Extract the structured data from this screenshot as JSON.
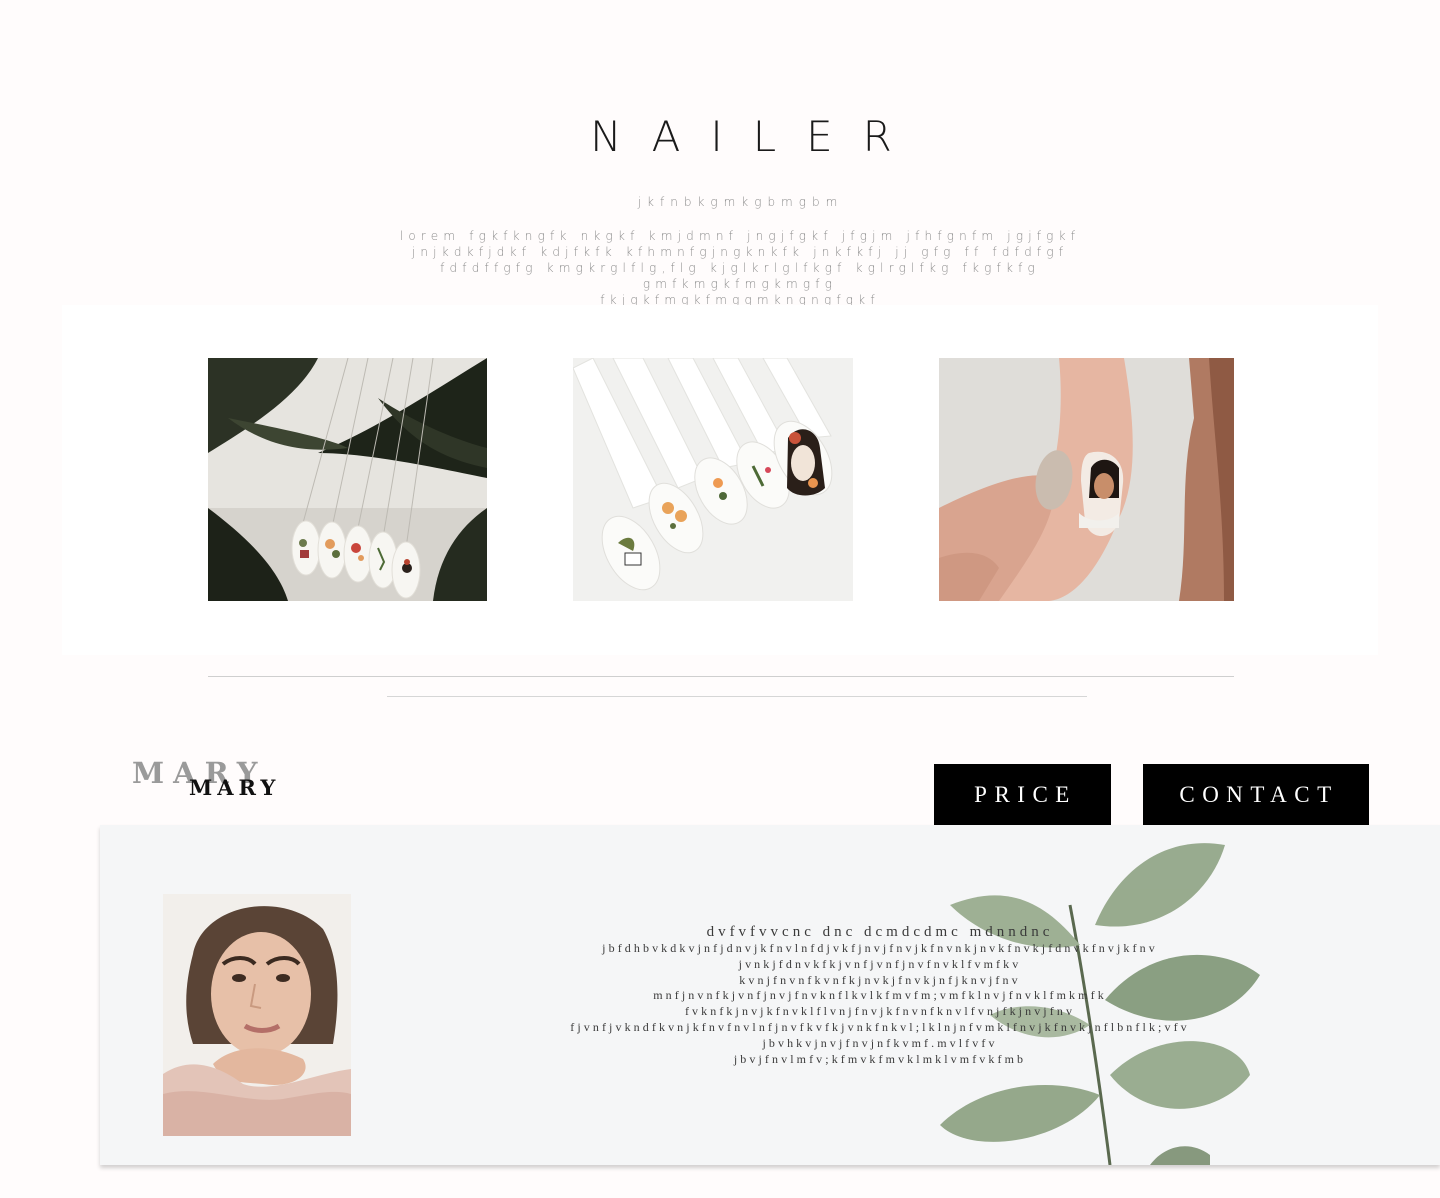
{
  "header": {
    "brand": "NAILER",
    "tagline": "jkfnbkgmkgbmgbm",
    "intro_lines": [
      "lorem fgkfkngfk nkgkf kmjdmnf jngjfgkf  jfgjm jfhfgnfm jgjfgkf",
      "jnjkdkfjdkf kdjfkfk kfhmnfgjngknkfk jnkfkfj jj gfg ff fdfdfgf",
      "fdfdffgfg kmgkrglflg,flg kjglkrlglfkgf kglrglfkg fkgfkfg",
      "gmfkmgkfmgkmgfg",
      "fkjgkfmgkfmggmkngngfgkf"
    ]
  },
  "gallery": {
    "images": [
      {
        "alt": "nail tips with floral art and palm leaves"
      },
      {
        "alt": "nail tips with floral and face designs"
      },
      {
        "alt": "hand with painted face on nail"
      }
    ]
  },
  "profile": {
    "name": "MARY",
    "name_echo": "MARY"
  },
  "nav": {
    "price": "PRICE",
    "contact": "CONTACT"
  },
  "about": {
    "lead": "dvfvfvvcnc dnc dcmdcdmc mdnndnc",
    "lines": [
      "jbfdhbvkdkvjnfjdnvjkfnvlnfdjvkfjnvjfnvjkfnvnkjnvkfnvkjfdnvkfnvjkfnv",
      "jvnkjfdnvkfkjvnfjvnfjnvfnvklfvmfkv",
      "kvnjfnvnfkvnfkjnvkjfnvkjnfjknvjfnv",
      "mnfjnvnfkjvnfjnvjfnvknflkvlkfmvfm;vmfklnvjfnvklfmkmfk",
      "fvknfkjnvjkfnvklflvnjfnvjkfnvnfknvlfvnjfkjnvjfnv",
      "fjvnfjvkndfkvnjkfnvfnvlnfjnvfkvfkjvnkfnkvl;lklnjnfvmklfnvjkfnvkjnflbnflk;vfv",
      "jbvhkvjnvjfnvjnfkvmf.mvlfvfv",
      "jbvjfnvlmfv;kfmvkfmvklmklvmfvkfmb"
    ]
  },
  "colors": {
    "page_bg": "#fffcfc",
    "button_bg": "#000000",
    "about_bg": "#f5f6f7",
    "muted_text": "#8c8c8c"
  }
}
